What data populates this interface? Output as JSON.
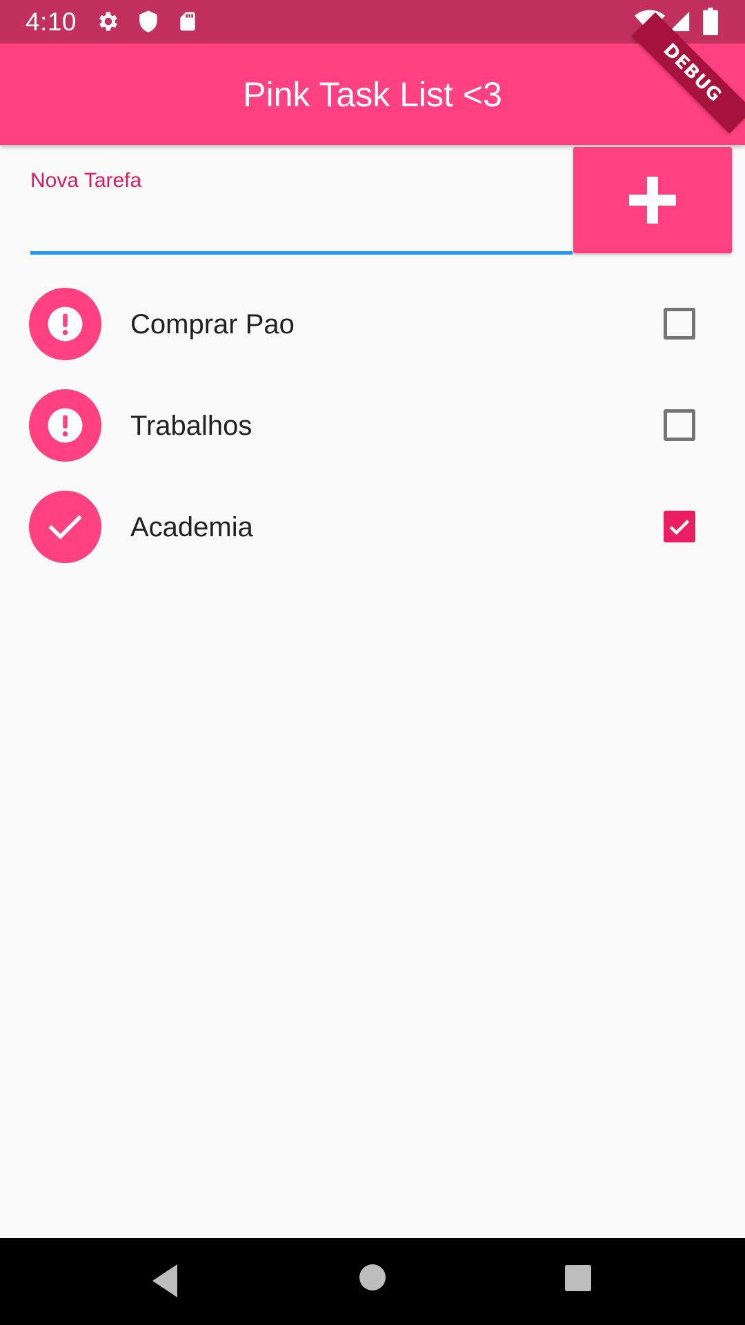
{
  "status_bar": {
    "time": "4:10",
    "left_icons": [
      "gear-icon",
      "shield-icon",
      "sd-card-icon"
    ],
    "right_icons": [
      "wifi-icon",
      "signal-icon",
      "battery-icon"
    ]
  },
  "debug_banner": "DEBUG",
  "app_bar": {
    "title": "Pink Task List <3",
    "color": "#ff4081"
  },
  "new_task": {
    "label": "Nova Tarefa",
    "value": "",
    "add_icon": "plus-icon"
  },
  "tasks": [
    {
      "title": "Comprar Pao",
      "done": false,
      "icon": "alert-icon"
    },
    {
      "title": "Trabalhos",
      "done": false,
      "icon": "alert-icon"
    },
    {
      "title": "Academia",
      "done": true,
      "icon": "check-icon"
    }
  ],
  "nav_bar": {
    "buttons": [
      "back-icon",
      "home-icon",
      "recents-icon"
    ]
  },
  "colors": {
    "status_bar": "#c2305f",
    "accent": "#ff4081",
    "checkbox_checked": "#e91e63",
    "input_underline": "#2196f3",
    "label": "#d81b60"
  }
}
